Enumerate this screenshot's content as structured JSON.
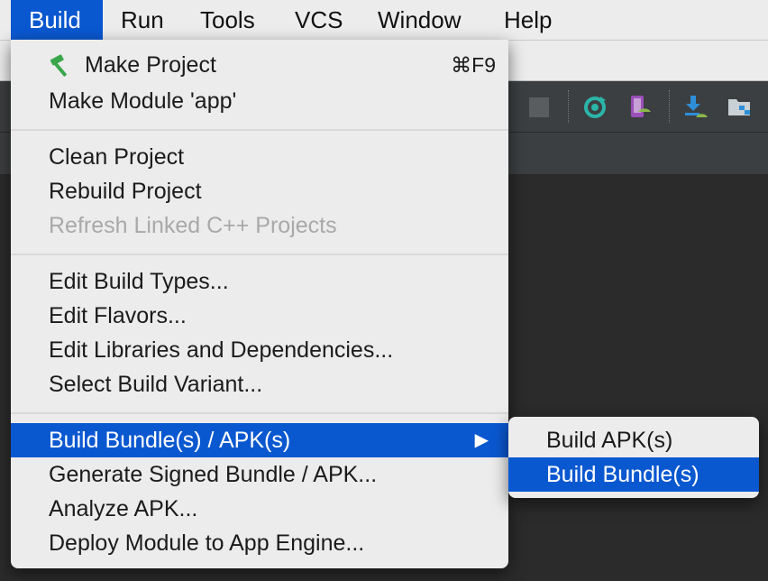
{
  "menubar": {
    "items": [
      {
        "label": "Build",
        "active": true
      },
      {
        "label": "Run"
      },
      {
        "label": "Tools"
      },
      {
        "label": "VCS"
      },
      {
        "label": "Window"
      },
      {
        "label": "Help"
      }
    ]
  },
  "build_menu": {
    "make_project": {
      "label": "Make Project",
      "shortcut": "⌘F9",
      "icon": "hammer-icon"
    },
    "make_module": {
      "label": "Make Module 'app'"
    },
    "clean_project": {
      "label": "Clean Project"
    },
    "rebuild_project": {
      "label": "Rebuild Project"
    },
    "refresh_cpp": {
      "label": "Refresh Linked C++ Projects",
      "disabled": true
    },
    "edit_build_types": {
      "label": "Edit Build Types..."
    },
    "edit_flavors": {
      "label": "Edit Flavors..."
    },
    "edit_libraries": {
      "label": "Edit Libraries and Dependencies..."
    },
    "select_variant": {
      "label": "Select Build Variant..."
    },
    "build_bundles": {
      "label": "Build Bundle(s) / APK(s)",
      "submenu_arrow": "▶",
      "selected": true
    },
    "generate_signed": {
      "label": "Generate Signed Bundle / APK..."
    },
    "analyze_apk": {
      "label": "Analyze APK..."
    },
    "deploy_module": {
      "label": "Deploy Module to App Engine..."
    }
  },
  "submenu": {
    "build_apk": {
      "label": "Build APK(s)"
    },
    "build_bundle": {
      "label": "Build Bundle(s)",
      "selected": true
    }
  },
  "toolbar_icons": [
    "stop-icon",
    "sync-icon",
    "avd-manager-icon",
    "sdk-download-icon",
    "project-structure-icon"
  ],
  "colors": {
    "selection": "#0a58d0",
    "menu_bg": "#ececec",
    "ide_bg": "#2b2b2b",
    "toolbar_bg": "#3c3f41",
    "hammer": "#3aa64c",
    "disabled_text": "#a9a9a9"
  }
}
